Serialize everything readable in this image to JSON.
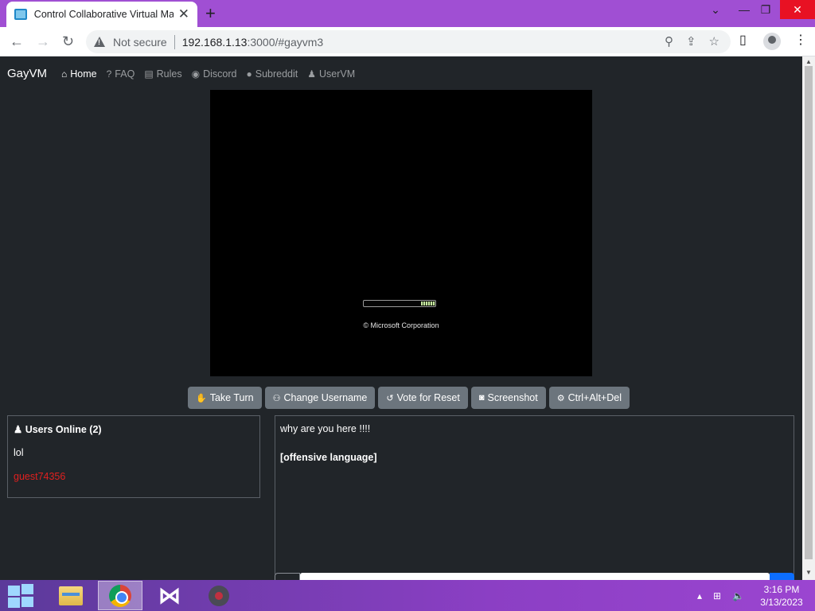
{
  "browser": {
    "tab_title": "Control Collaborative Virtual Machines",
    "not_secure": "Not secure",
    "url_host": "192.168.1.13",
    "url_rest": ":3000/#gayvm3"
  },
  "navbar": {
    "brand": "GayVM",
    "links": [
      {
        "label": "Home",
        "icon": "home-icon"
      },
      {
        "label": "FAQ",
        "icon": "question-icon"
      },
      {
        "label": "Rules",
        "icon": "clipboard-icon"
      },
      {
        "label": "Discord",
        "icon": "discord-icon"
      },
      {
        "label": "Subreddit",
        "icon": "reddit-icon"
      },
      {
        "label": "UserVM",
        "icon": "user-icon"
      }
    ]
  },
  "vm": {
    "copyright": "© Microsoft Corporation"
  },
  "buttons": [
    {
      "label": "Take Turn",
      "icon": "hand-icon"
    },
    {
      "label": "Change Username",
      "icon": "users-icon"
    },
    {
      "label": "Vote for Reset",
      "icon": "undo-icon"
    },
    {
      "label": "Screenshot",
      "icon": "camera-icon"
    },
    {
      "label": "Ctrl+Alt+Del",
      "icon": "gear-icon"
    }
  ],
  "users": {
    "title": "Users Online (2)",
    "list": [
      {
        "name": "lol",
        "color": "#ffffff"
      },
      {
        "name": "guest74356",
        "color": "#e0201f"
      }
    ]
  },
  "chat": {
    "messages": [
      {
        "text": "why are you here !!!!",
        "bold": false
      },
      {
        "text": "[offensive language]",
        "bold": true
      }
    ]
  },
  "taskbar": {
    "time": "3:16 PM",
    "date": "3/13/2023"
  },
  "colors": {
    "page_bg": "#212529",
    "button_bg": "#6c757d",
    "taskbar_accent": "#8b3fc4"
  }
}
